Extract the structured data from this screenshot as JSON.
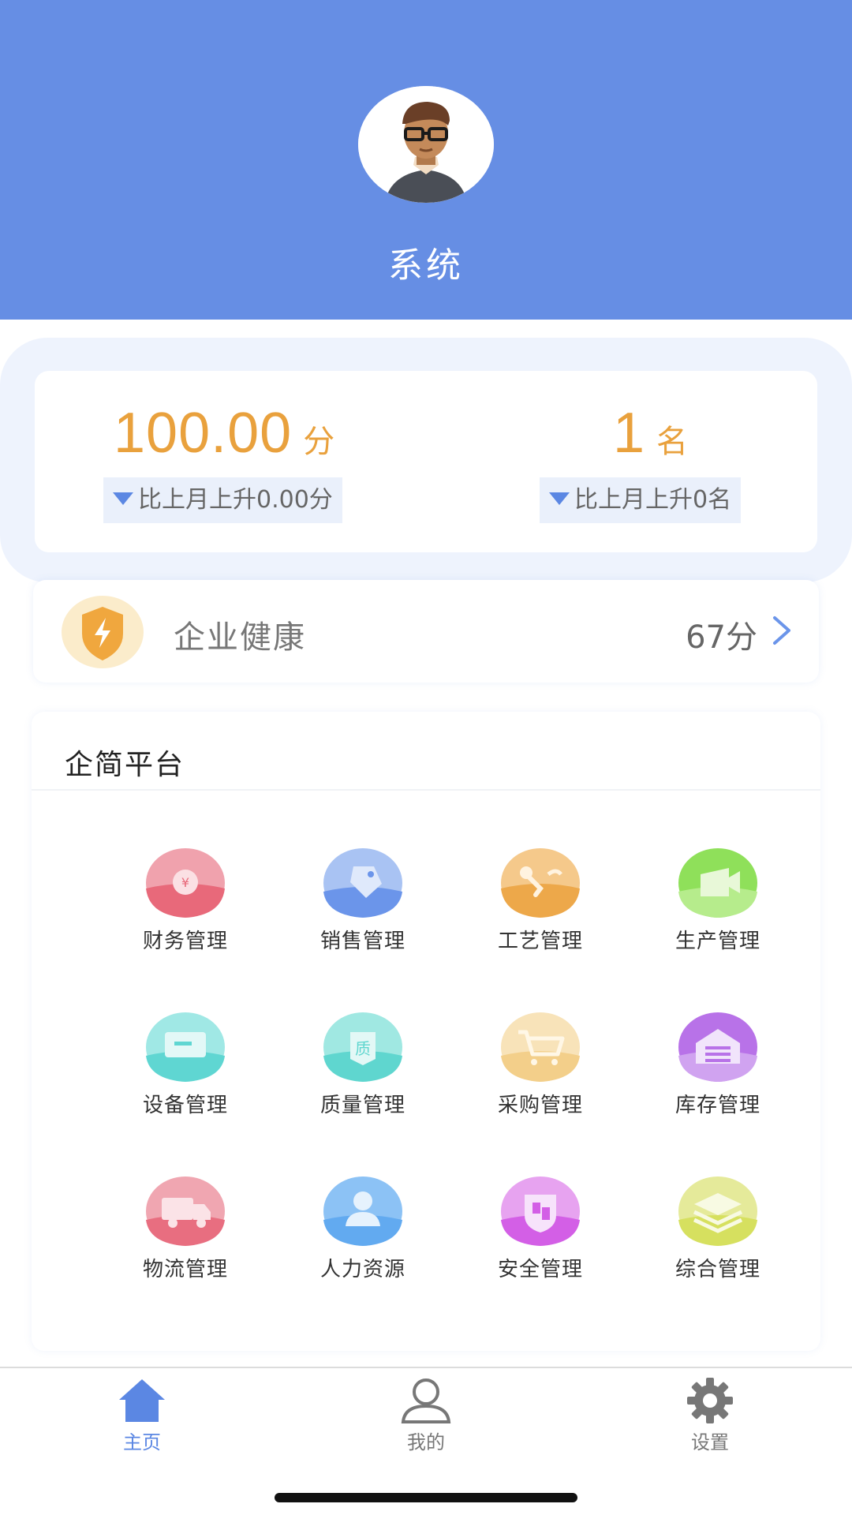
{
  "profile": {
    "name": "系统"
  },
  "score": {
    "value": "100.00",
    "unit": "分",
    "compare": "比上月上升0.00分"
  },
  "rank": {
    "value": "1",
    "unit": "名",
    "compare": "比上月上升0名"
  },
  "health": {
    "label": "企业健康",
    "score": "67分"
  },
  "platform": {
    "title": "企简平台",
    "items": [
      {
        "label": "财务管理",
        "icon": "finance-icon",
        "color": "#e8697a"
      },
      {
        "label": "销售管理",
        "icon": "sales-tag-icon",
        "color": "#6b95ea"
      },
      {
        "label": "工艺管理",
        "icon": "process-icon",
        "color": "#eda84a"
      },
      {
        "label": "生产管理",
        "icon": "production-icon",
        "color": "#8fe05a"
      },
      {
        "label": "设备管理",
        "icon": "equipment-icon",
        "color": "#5fd6d2"
      },
      {
        "label": "质量管理",
        "icon": "quality-icon",
        "color": "#5fd6cf"
      },
      {
        "label": "采购管理",
        "icon": "cart-icon",
        "color": "#f3cf8a"
      },
      {
        "label": "库存管理",
        "icon": "warehouse-icon",
        "color": "#b872e8"
      },
      {
        "label": "物流管理",
        "icon": "truck-icon",
        "color": "#e86e80"
      },
      {
        "label": "人力资源",
        "icon": "person-icon",
        "color": "#62aaf0"
      },
      {
        "label": "安全管理",
        "icon": "safety-icon",
        "color": "#d35fe6"
      },
      {
        "label": "综合管理",
        "icon": "layers-icon",
        "color": "#d6e05f"
      }
    ]
  },
  "tabs": [
    {
      "label": "主页",
      "icon": "home-icon",
      "active": true
    },
    {
      "label": "我的",
      "icon": "user-icon",
      "active": false
    },
    {
      "label": "设置",
      "icon": "gear-icon",
      "active": false
    }
  ],
  "colors": {
    "brand": "#668ee4",
    "accent": "#e9a13d",
    "active_tab": "#5b87e3",
    "inactive_tab": "#777777"
  }
}
